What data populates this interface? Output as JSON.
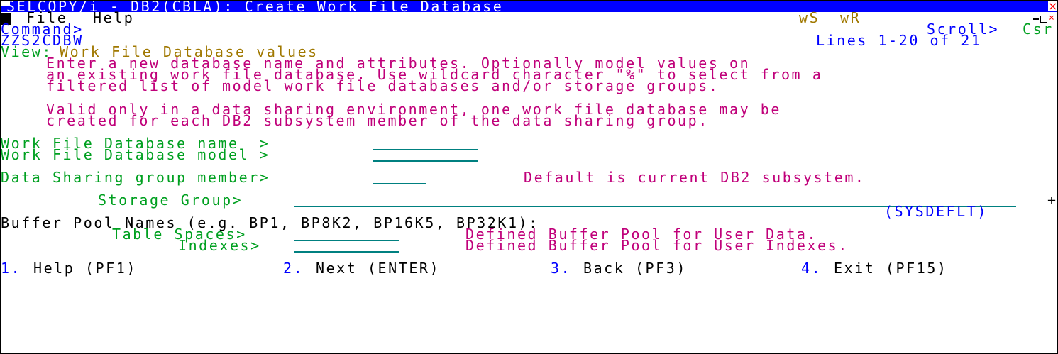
{
  "window": {
    "title": "SELCOPY/i - DB2(CBLA): Create Work File Database",
    "close_glyph": "×"
  },
  "menu": {
    "file": "File",
    "help": "Help",
    "status_ws": "wS",
    "status_wr": "wR"
  },
  "command": {
    "label": "Command>",
    "scroll_label": "Scroll>",
    "scroll_value": "Csr"
  },
  "panel": {
    "id": "ZZS2CDBW",
    "lines": "Lines 1-20 of 21"
  },
  "view": {
    "label": "View:",
    "value": "Work File Database values"
  },
  "instructions": [
    "Enter a new database name and attributes. Optionally model values on",
    "an existing work file database. Use wildcard character \"%\" to select from a",
    "filtered list of model work file databases and/or storage groups.",
    "Valid only in a data sharing environment, one work file database may be",
    "created for each DB2 subsystem member of the data sharing group."
  ],
  "fields": {
    "wf_name_label": "Work File Database name  >",
    "wf_name_value": "",
    "wf_model_label": "Work File Database model >",
    "wf_model_value": "",
    "member_label": "Data Sharing group member>",
    "member_value": "",
    "member_note": "Default is current DB2 subsystem.",
    "storage_label": "Storage Group>",
    "storage_value": "",
    "storage_more": "+",
    "storage_default": "(SYSDEFLT)",
    "bp_header": "Buffer Pool Names (e.g. BP1, BP8K2, BP16K5, BP32K1):",
    "ts_label": "Table Spaces>",
    "ts_value": "",
    "ts_note": "Defined Buffer Pool for User Data.",
    "ix_label": "Indexes>",
    "ix_value": "",
    "ix_note": "Defined Buffer Pool for User Indexes."
  },
  "actions": [
    {
      "num": "1.",
      "label": "Help (PF1)"
    },
    {
      "num": "2.",
      "label": "Next (ENTER)"
    },
    {
      "num": "3.",
      "label": "Back (PF3)"
    },
    {
      "num": "4.",
      "label": "Exit (PF15)"
    }
  ],
  "colors": {
    "title_bg": "#0000ff",
    "pink": "#c0007a",
    "blue": "#0000ff",
    "green": "#00a020",
    "olive": "#a07800",
    "field_underline": "#008080"
  }
}
